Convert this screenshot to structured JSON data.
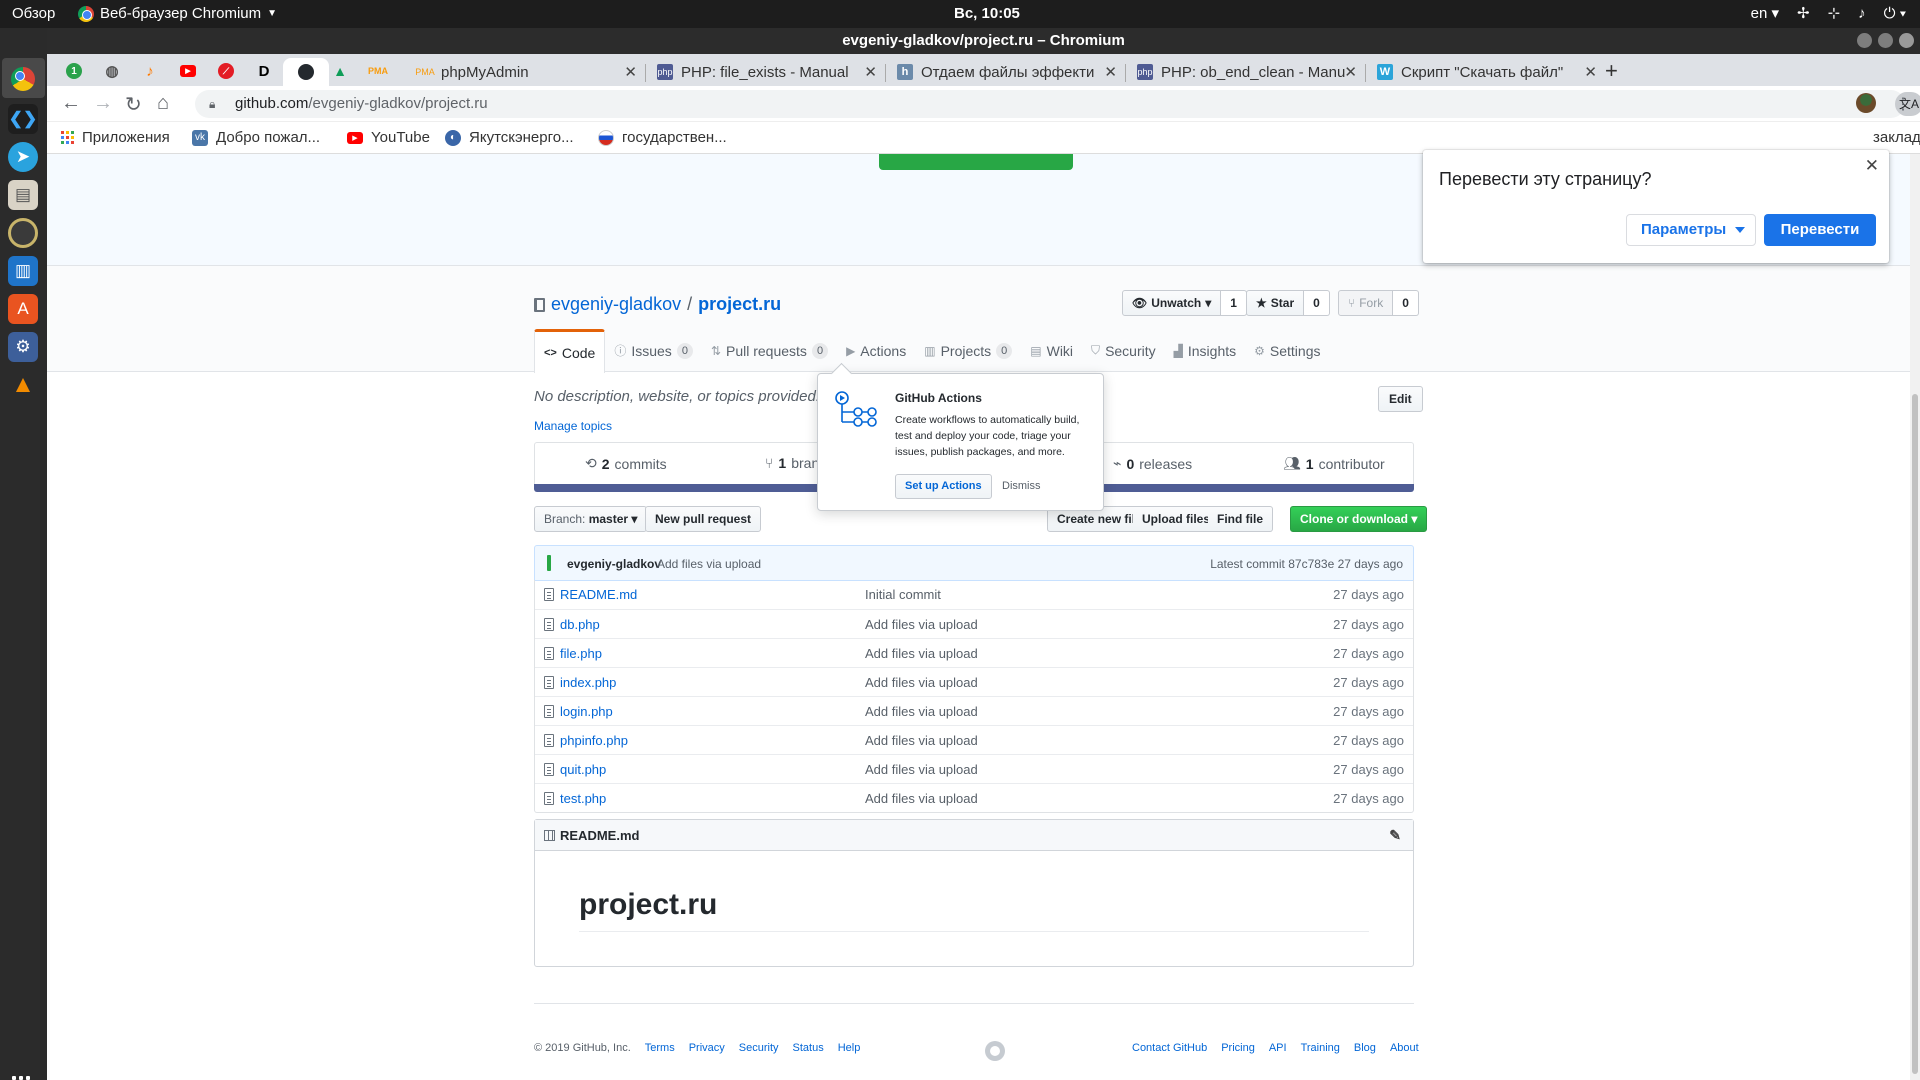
{
  "os": {
    "activities": "Обзор",
    "app_menu": "Веб-браузер Chromium",
    "clock": "Вс, 10:05",
    "keyboard_layout": "en"
  },
  "window": {
    "title": "evgeniy-gladkov/project.ru – Chromium"
  },
  "tabs": [
    {
      "label": "phpMyAdmin",
      "icon": "phpmyadmin-icon"
    },
    {
      "label": "PHP: file_exists - Manual",
      "icon": "php-icon"
    },
    {
      "label": "Отдаем файлы эффекти",
      "icon": "habr-icon"
    },
    {
      "label": "PHP: ob_end_clean - Manu",
      "icon": "php-icon"
    },
    {
      "label": "Скрипт \"Скачать файл\"",
      "icon": "w-icon"
    }
  ],
  "address": {
    "host": "github.com",
    "path": "/evgeniy-gladkov/project.ru"
  },
  "bookmarks": {
    "apps": "Приложения",
    "items": [
      "Добро пожал...",
      "YouTube",
      "Якутскэнерго...",
      "государствен..."
    ],
    "other": "закладки"
  },
  "translate_bubble": {
    "title": "Перевести эту страницу?",
    "options": "Параметры",
    "translate": "Перевести"
  },
  "repo": {
    "owner": "evgeniy-gladkov",
    "sep": "/",
    "name": "project.ru",
    "unwatch": "Unwatch",
    "watch_count": "1",
    "star": "Star",
    "star_count": "0",
    "fork": "Fork",
    "fork_count": "0"
  },
  "nav": {
    "code": "Code",
    "issues": "Issues",
    "issues_count": "0",
    "pulls": "Pull requests",
    "pulls_count": "0",
    "actions": "Actions",
    "projects": "Projects",
    "projects_count": "0",
    "wiki": "Wiki",
    "security": "Security",
    "insights": "Insights",
    "settings": "Settings"
  },
  "about": {
    "description": "No description, website, or topics provided.",
    "manage_topics": "Manage topics",
    "edit": "Edit"
  },
  "summary": {
    "commits_count": "2",
    "commits_label": "commits",
    "branches_count": "1",
    "branches_label": "bran",
    "releases_count": "0",
    "releases_label": "releases",
    "contributors_count": "1",
    "contributors_label": "contributor"
  },
  "file_nav": {
    "branch_label": "Branch:",
    "branch": "master",
    "new_pr": "New pull request",
    "create_file": "Create new file",
    "upload": "Upload files",
    "find": "Find file",
    "clone": "Clone or download"
  },
  "latest_commit": {
    "author": "evgeniy-gladkov",
    "message": "Add files via upload",
    "latest": "Latest commit 87c783e 27 days ago"
  },
  "files": [
    {
      "name": "README.md",
      "message": "Initial commit",
      "age": "27 days ago"
    },
    {
      "name": "db.php",
      "message": "Add files via upload",
      "age": "27 days ago"
    },
    {
      "name": "file.php",
      "message": "Add files via upload",
      "age": "27 days ago"
    },
    {
      "name": "index.php",
      "message": "Add files via upload",
      "age": "27 days ago"
    },
    {
      "name": "login.php",
      "message": "Add files via upload",
      "age": "27 days ago"
    },
    {
      "name": "phpinfo.php",
      "message": "Add files via upload",
      "age": "27 days ago"
    },
    {
      "name": "quit.php",
      "message": "Add files via upload",
      "age": "27 days ago"
    },
    {
      "name": "test.php",
      "message": "Add files via upload",
      "age": "27 days ago"
    }
  ],
  "readme": {
    "filename": "README.md",
    "heading": "project.ru"
  },
  "actions_popover": {
    "title": "GitHub Actions",
    "body": "Create workflows to automatically build, test and deploy your code, triage your issues, publish packages, and more.",
    "setup": "Set up Actions",
    "dismiss": "Dismiss"
  },
  "footer": {
    "copyright": "© 2019 GitHub, Inc.",
    "left_links": [
      "Terms",
      "Privacy",
      "Security",
      "Status",
      "Help"
    ],
    "right_links": [
      "Contact GitHub",
      "Pricing",
      "API",
      "Training",
      "Blog",
      "About"
    ]
  },
  "colors": {
    "link": "#0366d6",
    "green_button": "#28a745",
    "language_bar": "#4f5d95",
    "chrome_blue": "#1a73e8"
  }
}
